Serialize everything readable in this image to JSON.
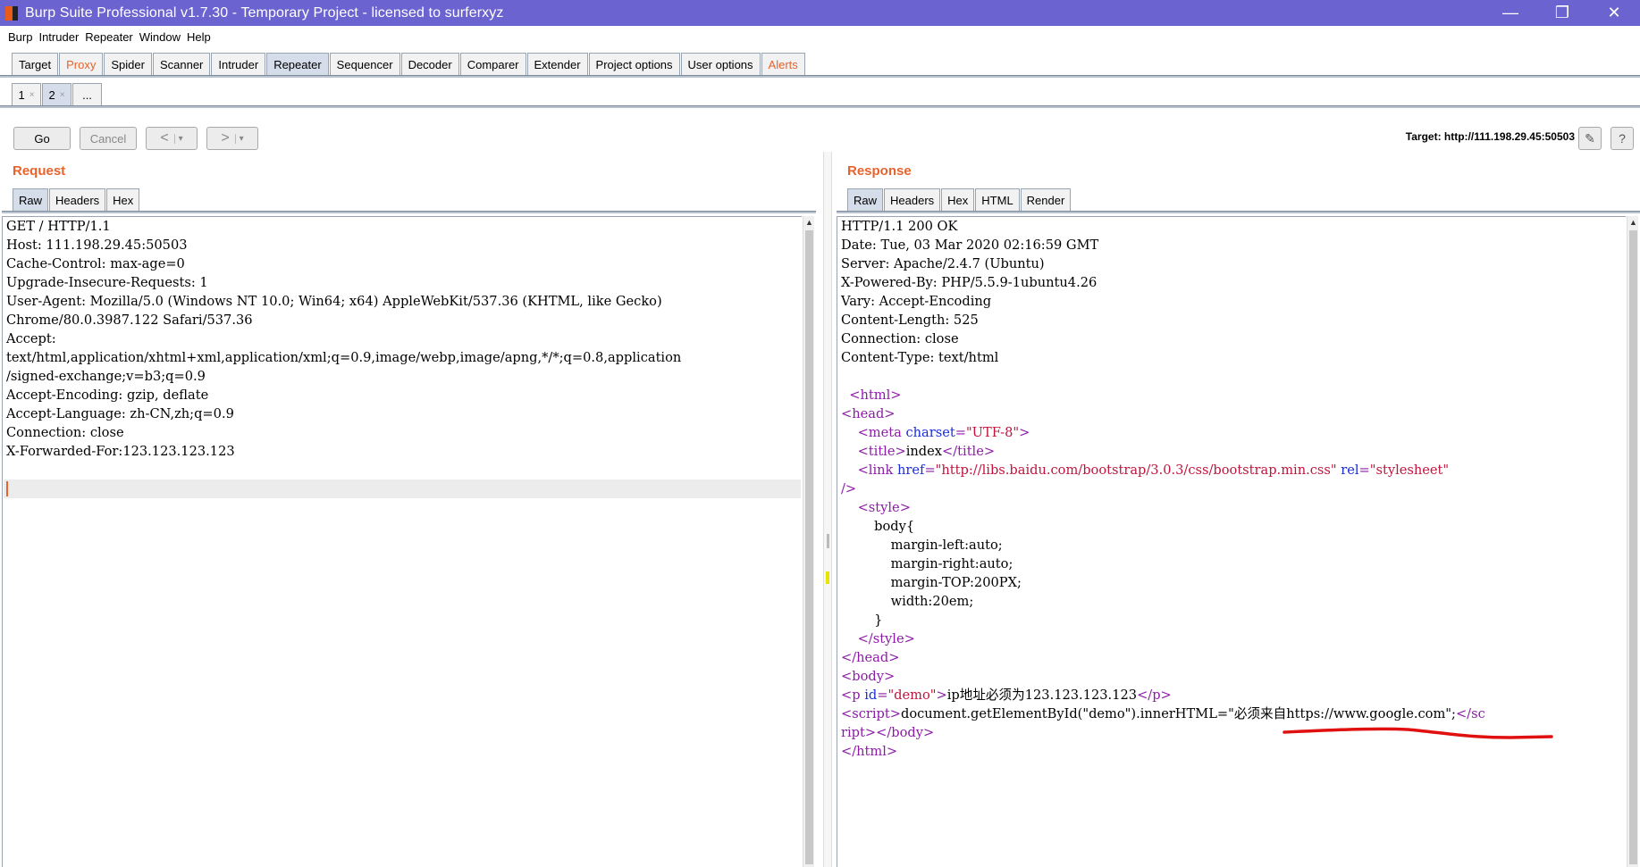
{
  "window": {
    "title": "Burp Suite Professional v1.7.30 - Temporary Project - licensed to surferxyz",
    "minimize": "—",
    "restore": "❐",
    "close": "✕"
  },
  "menu": [
    "Burp",
    "Intruder",
    "Repeater",
    "Window",
    "Help"
  ],
  "main_tabs": [
    "Target",
    "Proxy",
    "Spider",
    "Scanner",
    "Intruder",
    "Repeater",
    "Sequencer",
    "Decoder",
    "Comparer",
    "Extender",
    "Project options",
    "User options",
    "Alerts"
  ],
  "sub_tabs": [
    {
      "label": "1",
      "close": "×"
    },
    {
      "label": "2",
      "close": "×"
    },
    {
      "label": "..."
    }
  ],
  "toolbar": {
    "go": "Go",
    "cancel": "Cancel",
    "back": "<",
    "forward": ">",
    "dropdown": "▾",
    "target": "Target: http://111.198.29.45:50503",
    "edit_icon": "✎",
    "help_icon": "?"
  },
  "request": {
    "title": "Request",
    "tabs": [
      "Raw",
      "Headers",
      "Hex"
    ],
    "lines": [
      "GET / HTTP/1.1",
      "Host: 111.198.29.45:50503",
      "Cache-Control: max-age=0",
      "Upgrade-Insecure-Requests: 1",
      "User-Agent: Mozilla/5.0 (Windows NT 10.0; Win64; x64) AppleWebKit/537.36 (KHTML, like Gecko)",
      "Chrome/80.0.3987.122 Safari/537.36",
      "Accept:",
      "text/html,application/xhtml+xml,application/xml;q=0.9,image/webp,image/apng,*/*;q=0.8,application",
      "/signed-exchange;v=b3;q=0.9",
      "Accept-Encoding: gzip, deflate",
      "Accept-Language: zh-CN,zh;q=0.9",
      "Connection: close",
      "X-Forwarded-For:123.123.123.123",
      "",
      ""
    ]
  },
  "response": {
    "title": "Response",
    "tabs": [
      "Raw",
      "Headers",
      "Hex",
      "HTML",
      "Render"
    ],
    "header_lines": [
      "HTTP/1.1 200 OK",
      "Date: Tue, 03 Mar 2020 02:16:59 GMT",
      "Server: Apache/2.4.7 (Ubuntu)",
      "X-Powered-By: PHP/5.5.9-1ubuntu4.26",
      "Vary: Accept-Encoding",
      "Content-Length: 525",
      "Connection: close",
      "Content-Type: text/html",
      ""
    ],
    "body_lines": [
      [
        {
          "t": "  ",
          "c": "txt"
        },
        {
          "t": "<html>",
          "c": "tag"
        }
      ],
      [
        {
          "t": "<head>",
          "c": "tag"
        }
      ],
      [
        {
          "t": "    ",
          "c": "txt"
        },
        {
          "t": "<meta ",
          "c": "tag"
        },
        {
          "t": "charset",
          "c": "attr"
        },
        {
          "t": "=",
          "c": "tag"
        },
        {
          "t": "\"UTF-8\"",
          "c": "val"
        },
        {
          "t": ">",
          "c": "tag"
        }
      ],
      [
        {
          "t": "    ",
          "c": "txt"
        },
        {
          "t": "<title>",
          "c": "tag"
        },
        {
          "t": "index",
          "c": "txt"
        },
        {
          "t": "</title>",
          "c": "tag"
        }
      ],
      [
        {
          "t": "    ",
          "c": "txt"
        },
        {
          "t": "<link ",
          "c": "tag"
        },
        {
          "t": "href",
          "c": "attr"
        },
        {
          "t": "=",
          "c": "tag"
        },
        {
          "t": "\"http://libs.baidu.com/bootstrap/3.0.3/css/bootstrap.min.css\"",
          "c": "val"
        },
        {
          "t": " ",
          "c": "txt"
        },
        {
          "t": "rel",
          "c": "attr"
        },
        {
          "t": "=",
          "c": "tag"
        },
        {
          "t": "\"stylesheet\"",
          "c": "val"
        }
      ],
      [
        {
          "t": "/>",
          "c": "tag"
        }
      ],
      [
        {
          "t": "    ",
          "c": "txt"
        },
        {
          "t": "<style>",
          "c": "tag"
        }
      ],
      [
        {
          "t": "        body{",
          "c": "txt"
        }
      ],
      [
        {
          "t": "            margin-left:auto;",
          "c": "txt"
        }
      ],
      [
        {
          "t": "            margin-right:auto;",
          "c": "txt"
        }
      ],
      [
        {
          "t": "            margin-TOP:200PX;",
          "c": "txt"
        }
      ],
      [
        {
          "t": "            width:20em;",
          "c": "txt"
        }
      ],
      [
        {
          "t": "        }",
          "c": "txt"
        }
      ],
      [
        {
          "t": "    ",
          "c": "txt"
        },
        {
          "t": "</style>",
          "c": "tag"
        }
      ],
      [
        {
          "t": "</head>",
          "c": "tag"
        }
      ],
      [
        {
          "t": "<body>",
          "c": "tag"
        }
      ],
      [
        {
          "t": "<p ",
          "c": "tag"
        },
        {
          "t": "id",
          "c": "attr"
        },
        {
          "t": "=",
          "c": "tag"
        },
        {
          "t": "\"demo\"",
          "c": "val"
        },
        {
          "t": ">",
          "c": "tag"
        },
        {
          "t": "ip地址必须为123.123.123.123",
          "c": "txt"
        },
        {
          "t": "</p>",
          "c": "tag"
        }
      ],
      [
        {
          "t": "<script>",
          "c": "tag"
        },
        {
          "t": "document.getElementById(\"demo\").innerHTML=\"必须来自https://www.google.com\";",
          "c": "txt"
        },
        {
          "t": "</sc",
          "c": "tag"
        }
      ],
      [
        {
          "t": "ript>",
          "c": "tag"
        },
        {
          "t": "</body>",
          "c": "tag"
        }
      ],
      [
        {
          "t": "</html>",
          "c": "tag"
        }
      ]
    ]
  },
  "colors": {
    "titlebar": "#6b64d0",
    "accent_orange": "#e8622c",
    "active_tab": "#d4dde9",
    "tag": "#8b1ba6",
    "attr": "#1a2bd8",
    "value": "#c0143c",
    "annotation": "#e01010"
  }
}
